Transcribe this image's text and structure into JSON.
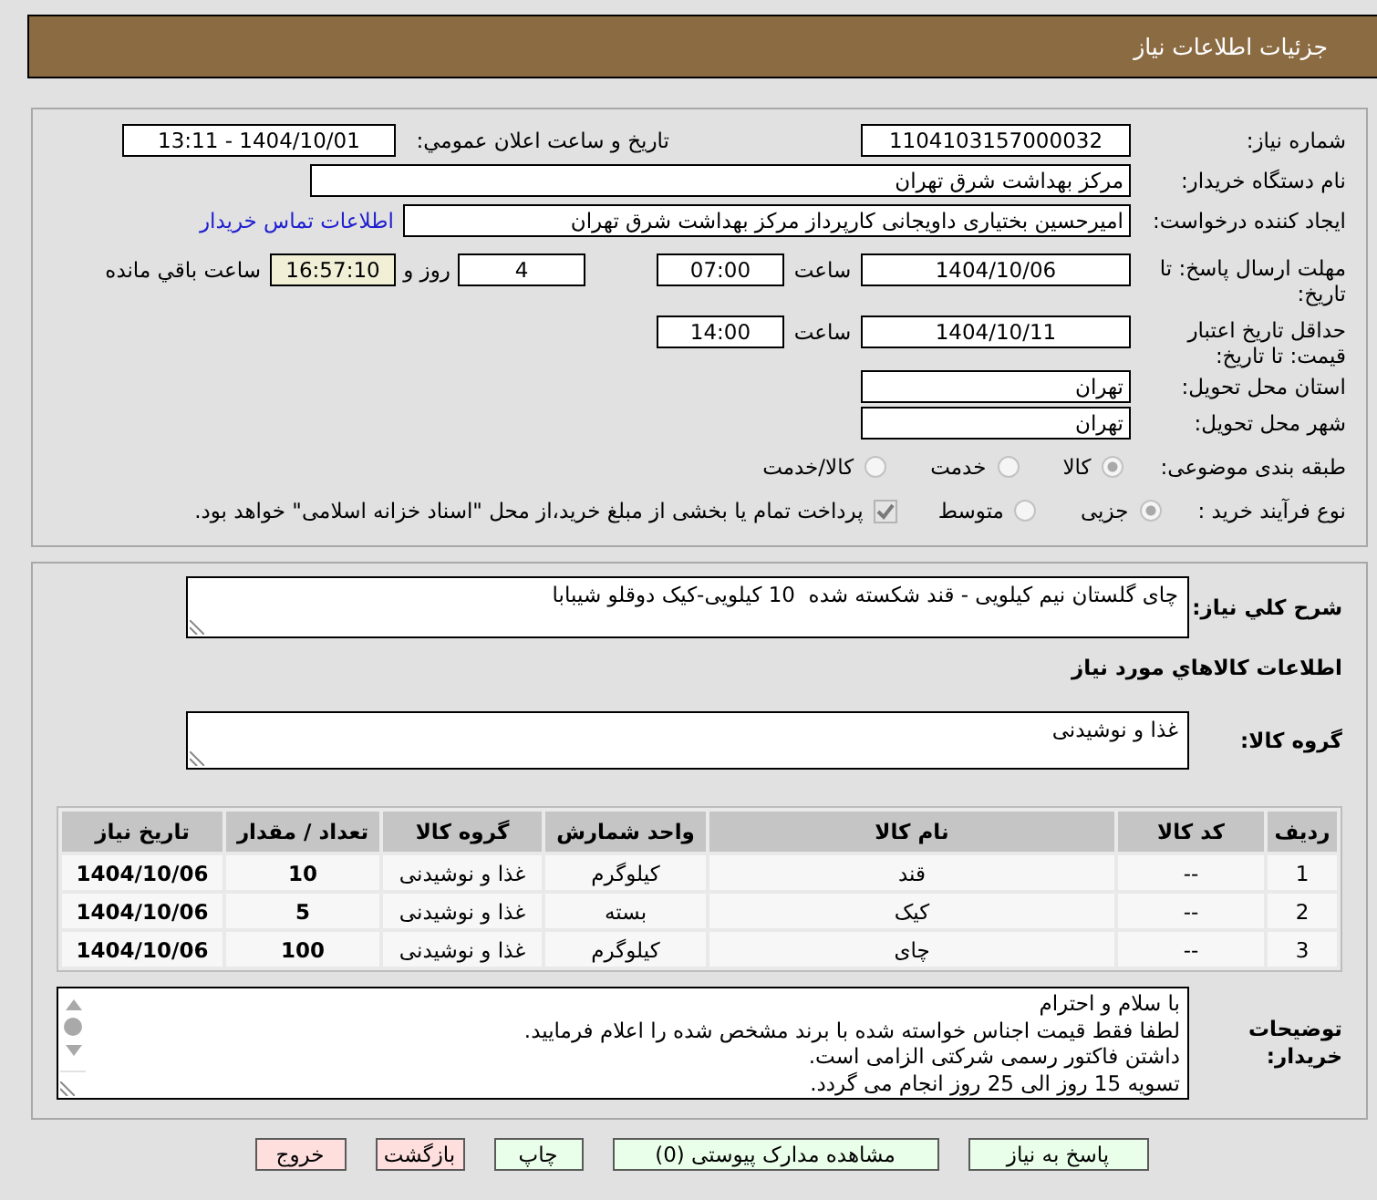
{
  "header": {
    "title": "جزئیات اطلاعات نیاز"
  },
  "details": {
    "need_number": {
      "label": "شماره نیاز:",
      "value": "1104103157000032"
    },
    "announcement": {
      "label": "تاریخ و ساعت اعلان عمومي:",
      "value": "1404/10/01 - 13:11"
    },
    "buyer_org": {
      "label": "نام دستگاه خریدار:",
      "value": "مرکز بهداشت شرق تهران"
    },
    "requester": {
      "label": "ایجاد کننده درخواست:",
      "value": "امیرحسین بختیاری داویجانی کارپرداز مرکز بهداشت شرق تهران",
      "contact_link": "اطلاعات تماس خریدار"
    },
    "response_deadline": {
      "label": "مهلت ارسال پاسخ: تا تاریخ:",
      "date": "1404/10/06",
      "time_label": "ساعت",
      "time": "07:00",
      "days": "4",
      "days_label": "روز و",
      "remaining": "16:57:10",
      "remaining_label": "ساعت باقي مانده"
    },
    "price_validity": {
      "label": "حداقل تاریخ اعتبار قیمت: تا تاریخ:",
      "date": "1404/10/11",
      "time_label": "ساعت",
      "time": "14:00"
    },
    "province": {
      "label": "استان محل تحویل:",
      "value": "تهران"
    },
    "city": {
      "label": "شهر محل تحویل:",
      "value": "تهران"
    },
    "category": {
      "label": "طبقه بندی موضوعی:",
      "options": [
        {
          "label": "کالا",
          "selected": true,
          "disabled": true
        },
        {
          "label": "خدمت",
          "selected": false,
          "disabled": true
        },
        {
          "label": "کالا/خدمت",
          "selected": false,
          "disabled": true
        }
      ]
    },
    "process": {
      "label": "نوع فرآیند خرید :",
      "options": [
        {
          "label": "جزیی",
          "selected": true,
          "disabled": true
        },
        {
          "label": "متوسط",
          "selected": false,
          "disabled": true
        }
      ],
      "treasury": {
        "label": "پرداخت تمام یا بخشی از مبلغ خرید،از محل \"اسناد خزانه اسلامی\" خواهد بود.",
        "checked": true,
        "disabled": true
      }
    }
  },
  "items": {
    "description": {
      "label": "شرح کلي نیاز:",
      "value": "چای گلستان نیم کیلویی - قند شکسته شده  10 کیلویی-کیک دوقلو شیبابا"
    },
    "heading": "اطلاعات کالاهاي مورد نیاز",
    "goods_group": {
      "label": "گروه کالا:",
      "value": "غذا و نوشیدنی"
    },
    "table": {
      "columns": [
        "ردیف",
        "کد کالا",
        "نام کالا",
        "واحد شمارش",
        "گروه کالا",
        "تعداد / مقدار",
        "تاریخ نیاز"
      ],
      "rows": [
        [
          "1",
          "--",
          "قند",
          "کیلوگرم",
          "غذا و نوشیدنی",
          "10",
          "1404/10/06"
        ],
        [
          "2",
          "--",
          "کیک",
          "بسته",
          "غذا و نوشیدنی",
          "5",
          "1404/10/06"
        ],
        [
          "3",
          "--",
          "چای",
          "کیلوگرم",
          "غذا و نوشیدنی",
          "100",
          "1404/10/06"
        ]
      ]
    },
    "buyer_notes": {
      "label": "توضیحات خریدار:",
      "lines": [
        "با سلام و احترام",
        "لطفا فقط قیمت اجناس خواسته شده با برند مشخص شده را اعلام فرمایید.",
        "داشتن فاکتور رسمی شرکتی الزامی است.",
        "تسویه 15 روز الی 25 روز انجام می گردد."
      ]
    }
  },
  "buttons": [
    {
      "label": "پاسخ به نیاز",
      "color": "#eaffea"
    },
    {
      "label": "مشاهده مدارک پیوستی (0)",
      "color": "#eaffea"
    },
    {
      "label": "چاپ",
      "color": "#eaffea"
    },
    {
      "label": "بازگشت",
      "color": "#ffdede"
    },
    {
      "label": "خروج",
      "color": "#ffdede"
    }
  ]
}
